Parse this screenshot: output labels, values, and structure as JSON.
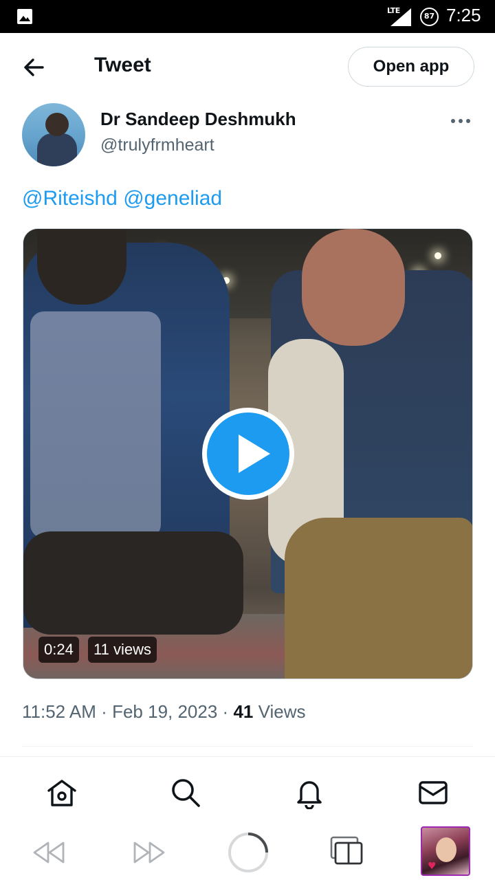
{
  "status_bar": {
    "network": "LTE",
    "battery": "87",
    "time": "7:25"
  },
  "header": {
    "title": "Tweet",
    "open_app_label": "Open app"
  },
  "author": {
    "name": "Dr Sandeep Deshmukh",
    "handle": "@trulyfrmheart"
  },
  "tweet": {
    "mentions": [
      "@Riteishd",
      "@geneliad"
    ]
  },
  "media": {
    "duration": "0:24",
    "views_label": "11 views"
  },
  "meta": {
    "time": "11:52 AM",
    "separator": "·",
    "date": "Feb 19, 2023",
    "views_count": "41",
    "views_word": "Views"
  },
  "tabs": [
    "home-icon",
    "search-icon",
    "notifications-icon",
    "messages-icon"
  ],
  "browser_bar": [
    "back-icon",
    "forward-icon",
    "loading-icon",
    "tabs-icon"
  ],
  "colors": {
    "accent": "#1d9bf0",
    "text": "#0f1419",
    "secondary": "#536471",
    "border": "#cfd9de"
  }
}
